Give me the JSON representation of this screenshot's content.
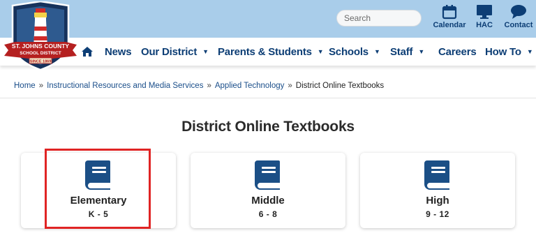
{
  "brand": {
    "logo_lines": [
      "ST. JOHNS COUNTY",
      "SCHOOL DISTRICT",
      "SINCE 1869"
    ],
    "colors": {
      "topbar": "#a9cdea",
      "navy": "#0d3e75",
      "book": "#1b4f86",
      "highlight": "#e02424"
    }
  },
  "search": {
    "placeholder": "Search"
  },
  "quick_links": [
    {
      "label": "Calendar",
      "icon": "calendar-icon"
    },
    {
      "label": "HAC",
      "icon": "monitor-icon"
    },
    {
      "label": "Contact",
      "icon": "chat-bubble-icon"
    }
  ],
  "nav": {
    "home_icon": "home-icon",
    "items": [
      {
        "label": "News",
        "dropdown": false
      },
      {
        "label": "Our District",
        "dropdown": true
      },
      {
        "label": "Parents & Students",
        "dropdown": true
      },
      {
        "label": "Schools",
        "dropdown": true
      },
      {
        "label": "Staff",
        "dropdown": true
      },
      {
        "label": "Careers",
        "dropdown": false
      },
      {
        "label": "How To",
        "dropdown": true
      }
    ],
    "caret": "▼"
  },
  "breadcrumb": {
    "links": [
      "Home",
      "Instructional Resources and Media Services",
      "Applied Technology"
    ],
    "separator": "»",
    "current": "District Online Textbooks"
  },
  "page": {
    "title": "District Online Textbooks"
  },
  "cards": [
    {
      "name": "Elementary",
      "grades": "K - 5",
      "icon": "book-icon",
      "highlighted": true
    },
    {
      "name": "Middle",
      "grades": "6 - 8",
      "icon": "book-icon",
      "highlighted": false
    },
    {
      "name": "High",
      "grades": "9 - 12",
      "icon": "book-icon",
      "highlighted": false
    }
  ]
}
